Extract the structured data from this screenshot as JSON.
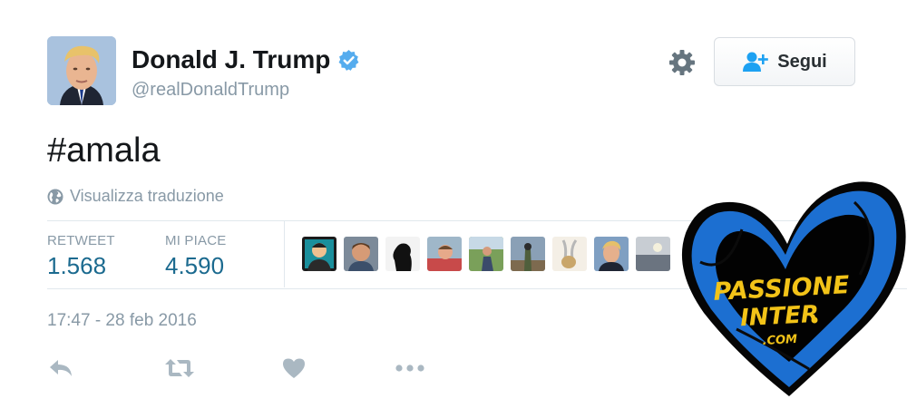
{
  "header": {
    "display_name": "Donald J. Trump",
    "handle": "@realDonaldTrump",
    "follow_label": "Segui"
  },
  "tweet": {
    "text": "#amala",
    "translate_label": "Visualizza traduzione",
    "timestamp": "17:47 - 28 feb 2016"
  },
  "stats": {
    "retweet_label": "RETWEET",
    "retweet_count": "1.568",
    "likes_label": "MI PIACE",
    "likes_count": "4.590"
  },
  "overlay": {
    "logo_line1": "PASSIONE",
    "logo_line2": "INTER",
    "logo_line3": ".COM"
  },
  "colors": {
    "verified": "#55acee",
    "stat_value": "#1b6a8f",
    "muted": "#8899a6",
    "icon": "#aab8c2",
    "logo_blue": "#1c6fd1",
    "logo_yellow": "#f2c318"
  },
  "icons": {
    "verified": "verified-badge-icon",
    "settings": "gear-icon",
    "follow": "add-user-icon",
    "translate": "globe-icon",
    "reply": "reply-icon",
    "retweet": "retweet-icon",
    "like": "heart-icon",
    "more": "more-dots-icon"
  }
}
